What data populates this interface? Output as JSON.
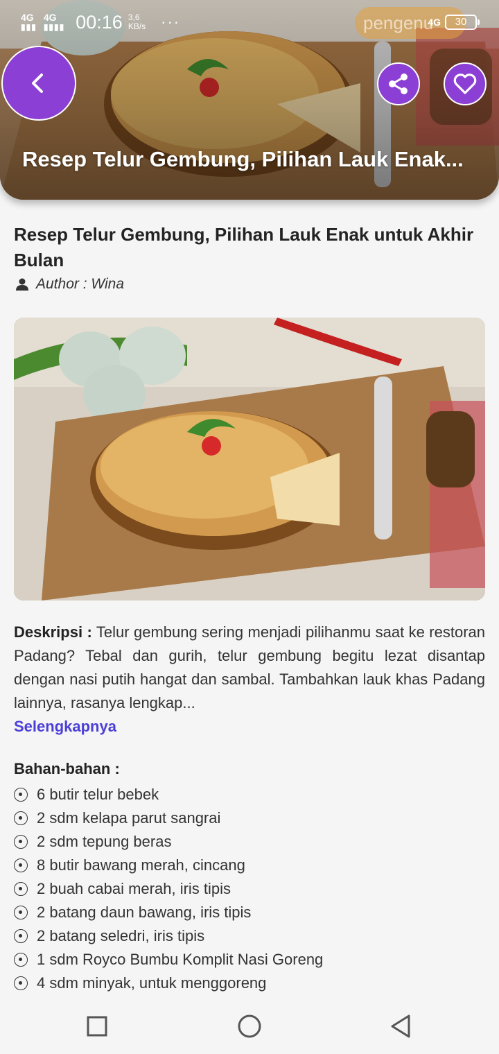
{
  "status_bar": {
    "network_1": "4G",
    "network_2": "4G",
    "time": "00:16",
    "speed_value": "3,6",
    "speed_unit": "KB/s",
    "overflow": "···",
    "network_right": "4G",
    "battery": "30",
    "background_chip": "pengenu"
  },
  "header": {
    "title": "Resep Telur Gembung, Pilihan Lauk Enak...",
    "back_icon": "chevron-left-icon",
    "share_icon": "share-icon",
    "favorite_icon": "heart-icon",
    "accent": "#8c3fd4"
  },
  "article": {
    "title": "Resep Telur Gembung, Pilihan Lauk Enak untuk Akhir Bulan",
    "author": "Author : Wina",
    "description_label": "Deskripsi :",
    "description": "Telur gembung sering menjadi pilihanmu saat ke restoran Padang? Tebal dan gurih, telur gembung begitu lezat disantap dengan nasi putih hangat dan sambal. Tambahkan lauk khas Padang lainnya, rasanya lengkap...",
    "more_link": "Selengkapnya",
    "link_color": "#4b3fd8"
  },
  "ingredients": {
    "heading": "Bahan-bahan :",
    "items": [
      "6 butir telur bebek",
      "2 sdm kelapa parut sangrai",
      "2 sdm tepung beras",
      "8 butir bawang merah, cincang",
      "2 buah cabai merah, iris tipis",
      "2 batang daun bawang, iris tipis",
      "2 batang seledri, iris tipis",
      "1 sdm Royco Bumbu Komplit Nasi Goreng",
      "4 sdm minyak, untuk menggoreng"
    ]
  },
  "navbar": {
    "recent_icon": "square-icon",
    "home_icon": "circle-icon",
    "back_icon": "triangle-back-icon"
  }
}
